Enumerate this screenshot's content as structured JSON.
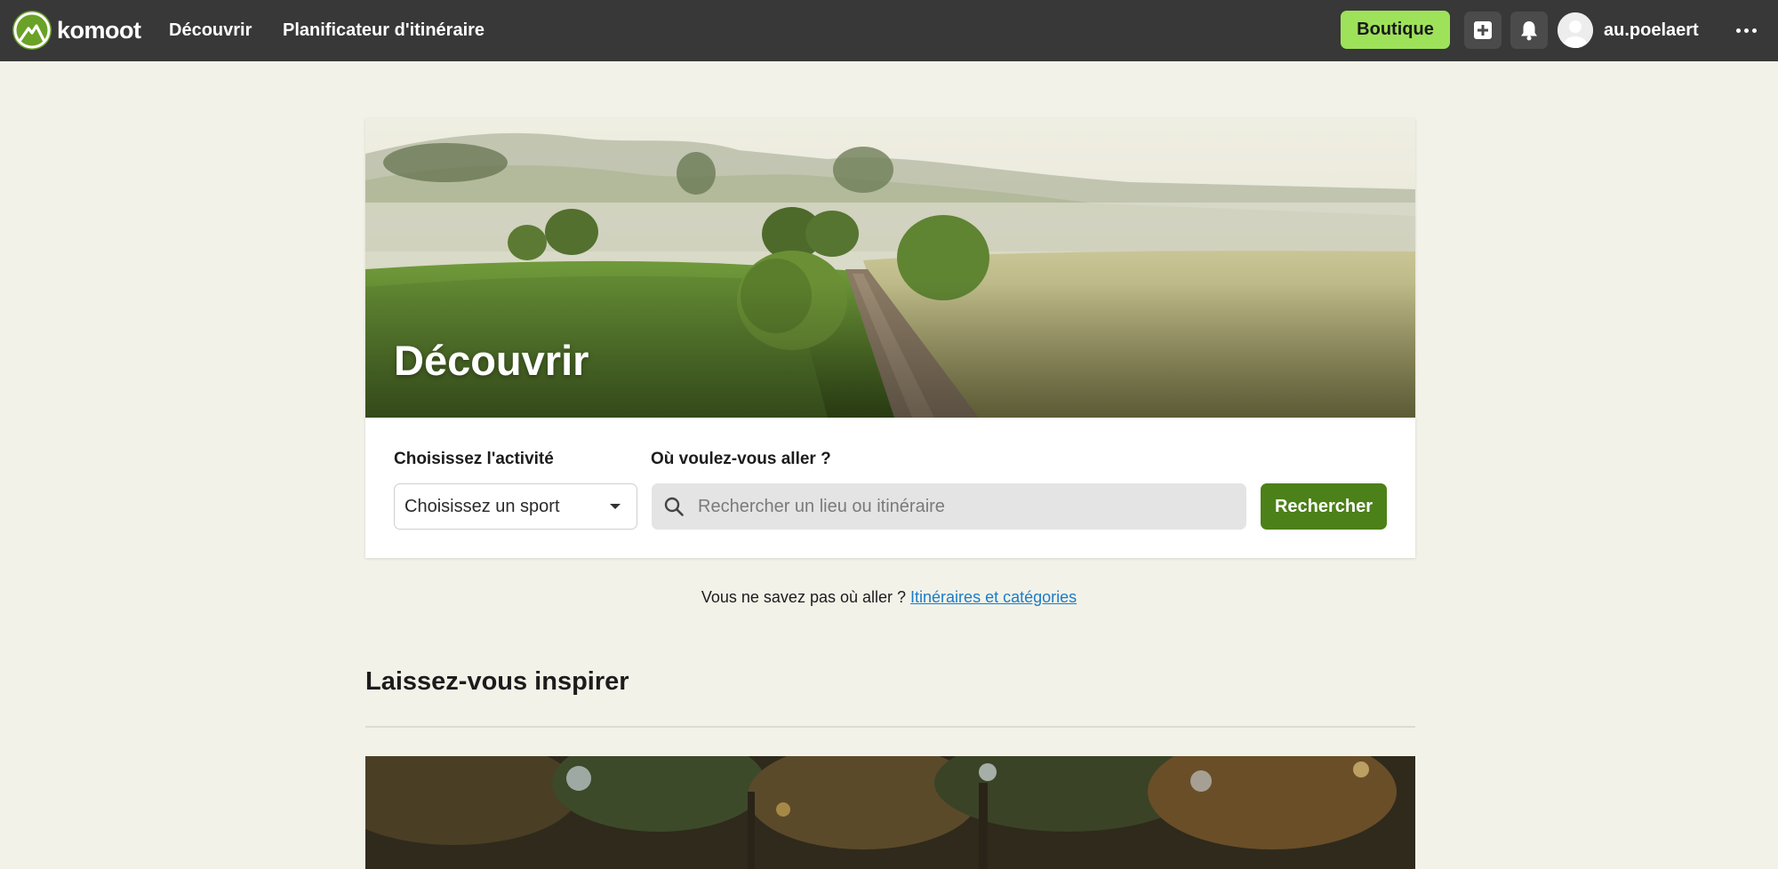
{
  "header": {
    "brand": "komoot",
    "nav": {
      "discover": "Découvrir",
      "planner": "Planificateur d'itinéraire"
    },
    "shop_label": "Boutique",
    "username": "au.poelaert"
  },
  "hero": {
    "title": "Découvrir",
    "activity_label": "Choisissez l'activité",
    "sport_select_value": "Choisissez un sport",
    "where_label": "Où voulez-vous aller ?",
    "search_placeholder": "Rechercher un lieu ou itinéraire",
    "search_button": "Rechercher"
  },
  "hint": {
    "text": "Vous ne savez pas où aller ?",
    "link": "Itinéraires et catégories"
  },
  "inspiration": {
    "title": "Laissez-vous inspirer"
  },
  "colors": {
    "topbar": "#383838",
    "brand_green": "#6aa127",
    "shop_button": "#9ee25a",
    "search_button": "#4c8018",
    "page_background": "#f3f2e9",
    "link": "#1a7cc9"
  },
  "icons": [
    "komoot-logo-icon",
    "plus-icon",
    "bell-icon",
    "avatar-icon",
    "more-icon",
    "search-icon",
    "chevron-down-icon"
  ]
}
